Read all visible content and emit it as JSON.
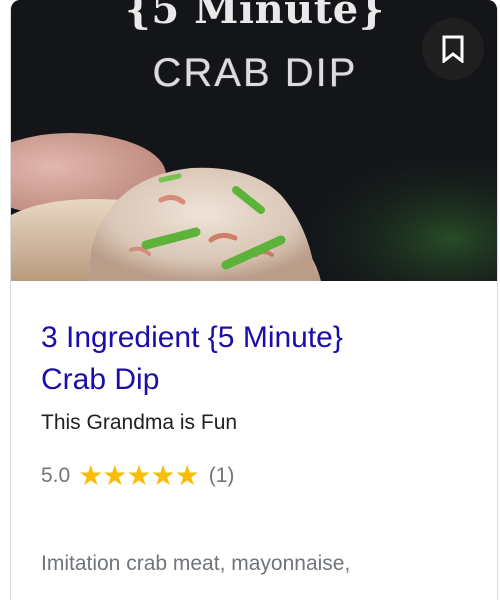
{
  "card": {
    "image": {
      "overlay_line1": "{5 Minute}",
      "overlay_line2": "CRAB DIP"
    },
    "save_icon": "bookmark-icon",
    "title_line1": "3 Ingredient {5 Minute}",
    "title_line2": "Crab Dip",
    "source": "This Grandma is Fun",
    "rating_value": "5.0",
    "rating_stars": 5,
    "rating_stars_text": "★★★★★",
    "rating_count": "(1)",
    "description": "Imitation crab meat, mayonnaise,"
  },
  "colors": {
    "title_link": "#1a0dab",
    "star": "#fbbc04",
    "muted_text": "#70757a",
    "image_background": "#131519"
  }
}
